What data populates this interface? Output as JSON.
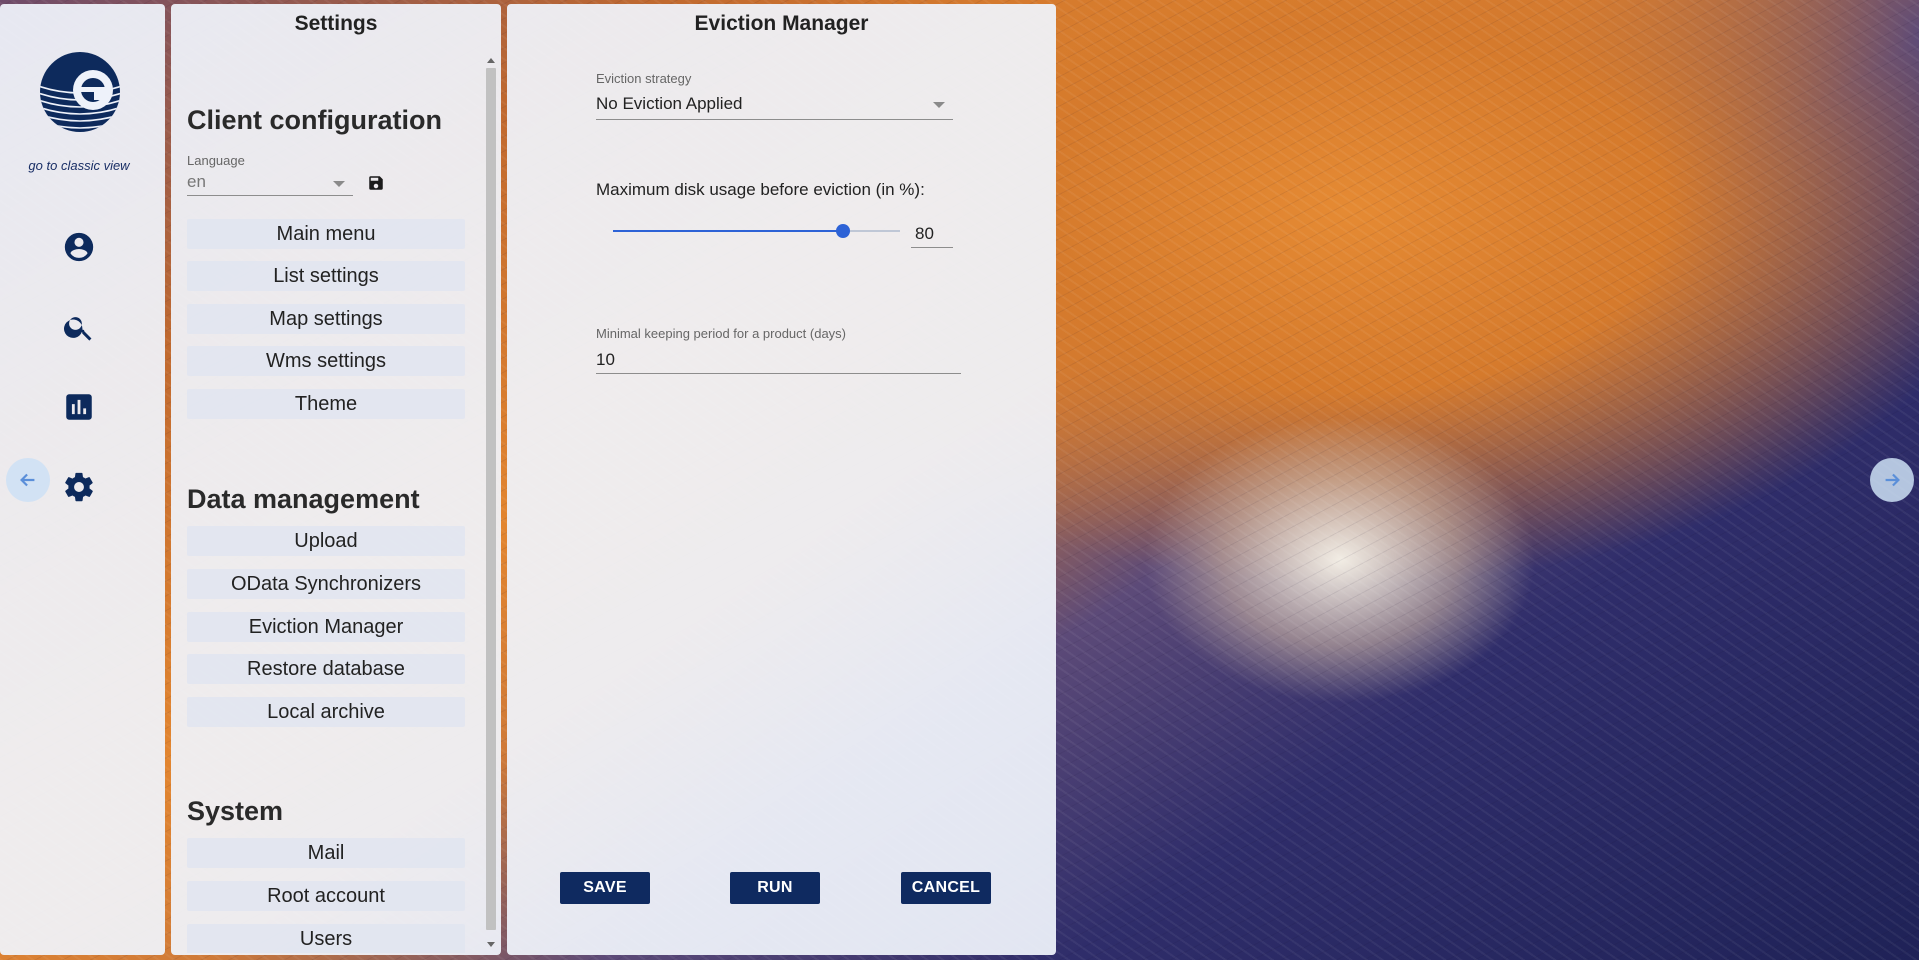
{
  "nav": {
    "classic_view_link": "go to classic view",
    "icons": [
      "account-circle-icon",
      "search-icon",
      "bar-chart-icon",
      "gear-icon"
    ]
  },
  "settings": {
    "title": "Settings",
    "client_configuration": {
      "title": "Client configuration",
      "language_label": "Language",
      "language_value": "en",
      "items": [
        "Main menu",
        "List settings",
        "Map settings",
        "Wms settings",
        "Theme"
      ]
    },
    "data_management": {
      "title": "Data management",
      "items": [
        "Upload",
        "OData Synchronizers",
        "Eviction Manager",
        "Restore database",
        "Local archive"
      ]
    },
    "system": {
      "title": "System",
      "items": [
        "Mail",
        "Root account",
        "Users"
      ]
    }
  },
  "eviction_manager": {
    "title": "Eviction Manager",
    "strategy_label": "Eviction strategy",
    "strategy_value": "No Eviction Applied",
    "disk_usage_label": "Maximum disk usage before eviction (in %):",
    "disk_usage_value": "80",
    "disk_usage_fraction": 0.8,
    "keeping_period_label": "Minimal keeping period for a product (days)",
    "keeping_period_value": "10",
    "buttons": {
      "save": "SAVE",
      "run": "RUN",
      "cancel": "CANCEL"
    }
  },
  "colors": {
    "accent": "#0f2a60",
    "slider": "#2d62d6",
    "arrow": "#5b8fd9"
  }
}
